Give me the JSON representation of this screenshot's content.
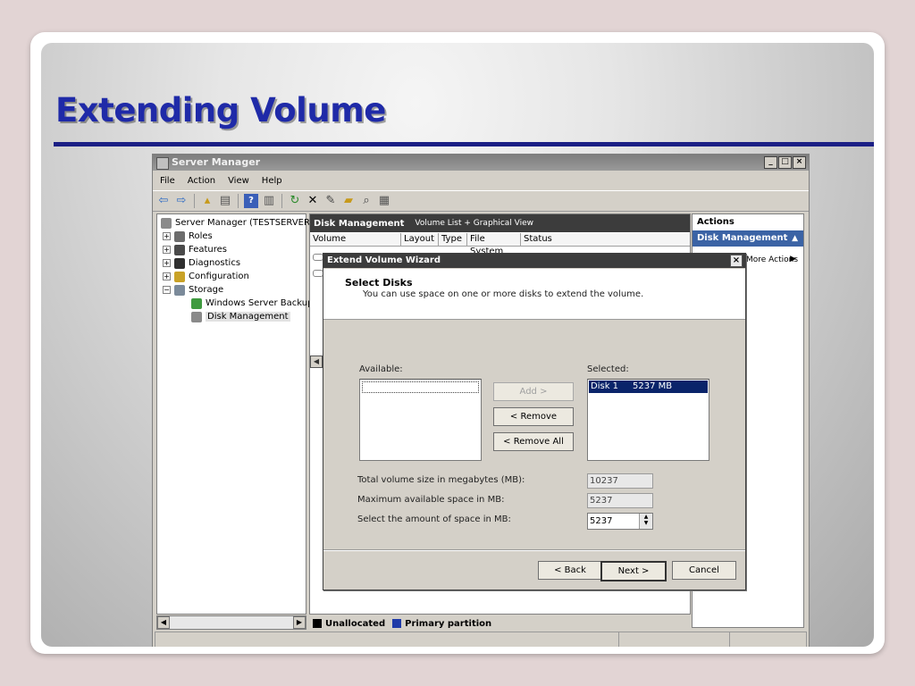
{
  "slide": {
    "title": "Extending Volume"
  },
  "window": {
    "title": "Server Manager",
    "menu": [
      "File",
      "Action",
      "View",
      "Help"
    ]
  },
  "tree": {
    "items": [
      {
        "label": "Server Manager (TESTSERVER)",
        "icon": "server-icon"
      },
      {
        "label": "Roles",
        "icon": "roles-icon"
      },
      {
        "label": "Features",
        "icon": "features-icon"
      },
      {
        "label": "Diagnostics",
        "icon": "diagnostics-icon"
      },
      {
        "label": "Configuration",
        "icon": "configuration-icon"
      },
      {
        "label": "Storage",
        "icon": "storage-icon"
      },
      {
        "label": "Windows Server Backup",
        "icon": "backup-icon"
      },
      {
        "label": "Disk Management",
        "icon": "disk-icon"
      }
    ]
  },
  "center": {
    "header_title": "Disk Management",
    "header_view": "Volume List + Graphical View",
    "columns": [
      "Volume",
      "Layout",
      "Type",
      "File System",
      "Status"
    ]
  },
  "legend": {
    "unallocated": "Unallocated",
    "primary": "Primary partition"
  },
  "actions": {
    "title": "Actions",
    "section": "Disk Management",
    "more": "More Actions"
  },
  "wizard": {
    "title": "Extend Volume Wizard",
    "heading": "Select Disks",
    "description": "You can use space on one or more disks to extend the volume.",
    "available_label": "Available:",
    "selected_label": "Selected:",
    "selected_items": [
      {
        "disk": "Disk 1",
        "size": "5237 MB"
      }
    ],
    "add_label": "Add >",
    "remove_label": "< Remove",
    "remove_all_label": "< Remove All",
    "total_label": "Total volume size in megabytes (MB):",
    "total_value": "10237",
    "max_label": "Maximum available space in MB:",
    "max_value": "5237",
    "amount_label": "Select the amount of space in MB:",
    "amount_value": "5237",
    "back_label": "< Back",
    "next_label": "Next >",
    "cancel_label": "Cancel"
  },
  "colors": {
    "title_text": "#1f2aa8",
    "rule": "#1b1f85",
    "selection": "#0a246a",
    "actions_header": "#3b63a5",
    "unallocated": "#000000",
    "primary_partition": "#1f3aa8"
  }
}
